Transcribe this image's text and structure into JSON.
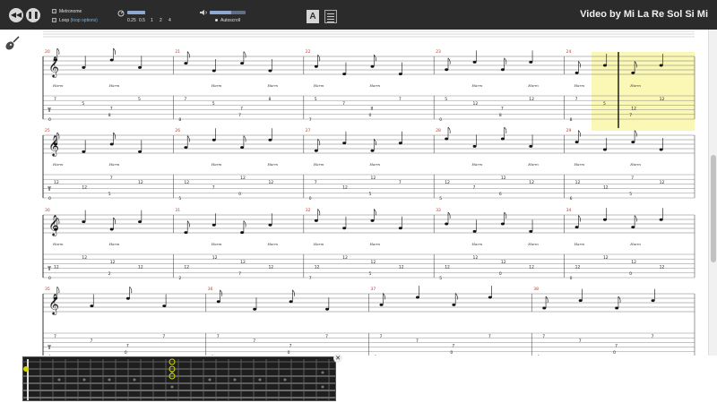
{
  "toolbar": {
    "rewind_icon": "rewind-icon",
    "pause_icon": "pause-icon",
    "metronome_label": "Metronome",
    "loop_label": "Loop",
    "loop_link": "(loop options)",
    "speed_values": [
      "0.25",
      "0.5",
      "1",
      "2",
      "4"
    ],
    "autoscroll_label": "Autoscroll",
    "font_button_label": "A",
    "video_title": "Video by Mi La Re Sol Si Mi"
  },
  "score": {
    "highlight_color": "#fbf7b5",
    "harm_label": "Harm",
    "systems": [
      {
        "measures": [
          "20",
          "21",
          "22",
          "23",
          "24"
        ],
        "tab_notes": [
          "7",
          "5",
          "7",
          "5",
          "7",
          "5",
          "7",
          "8",
          "5",
          "7",
          "8",
          "7",
          "5",
          "12",
          "7",
          "12",
          "7",
          "5",
          "12",
          "12",
          "7"
        ],
        "bass_notes": [
          "0",
          "8",
          "7",
          "0",
          "8",
          "7",
          "0",
          "8",
          "7",
          "0",
          "7",
          "0"
        ]
      },
      {
        "measures": [
          "25",
          "26",
          "27",
          "28",
          "29"
        ],
        "tab_notes": [
          "12",
          "12",
          "7",
          "12",
          "12",
          "7",
          "12",
          "12",
          "7",
          "12",
          "12",
          "7",
          "12",
          "7",
          "12",
          "12"
        ],
        "bass_notes": [
          "0",
          "5",
          "0",
          "5",
          "6",
          "5",
          "0",
          "5",
          "7",
          "0",
          "5",
          "0"
        ]
      },
      {
        "measures": [
          "30",
          "31",
          "32",
          "33",
          "34"
        ],
        "tab_notes": [
          "12",
          "12",
          "12",
          "12",
          "12",
          "12",
          "12",
          "12",
          "12",
          "12",
          "12",
          "12"
        ],
        "bass_notes": [
          "0",
          "2",
          "7",
          "5",
          "0",
          "0",
          "5",
          "7",
          "0",
          "0",
          "0",
          "0"
        ]
      },
      {
        "measures": [
          "35",
          "36",
          "37",
          "38"
        ],
        "tab_notes": [
          "7",
          "7",
          "7",
          "7",
          "7",
          "7",
          "7",
          "7",
          "7",
          "7",
          "7",
          "7"
        ],
        "bass_notes": [
          "0",
          "0",
          "0",
          "0",
          "0",
          "0",
          "0",
          "0"
        ]
      }
    ]
  },
  "fretboard": {
    "active_color": "#cfd900",
    "close_icon": "close-icon"
  }
}
